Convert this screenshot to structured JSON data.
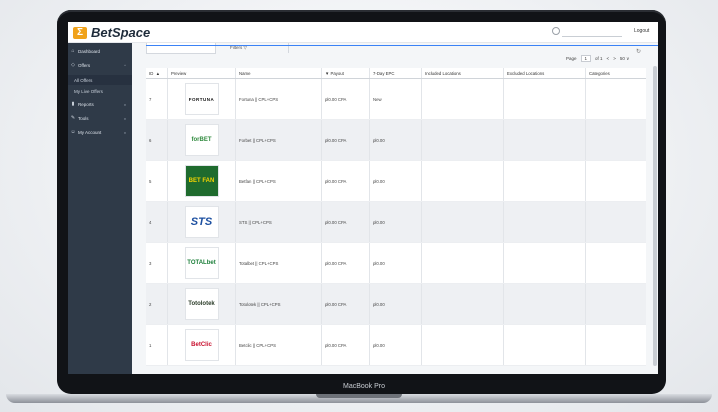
{
  "app": {
    "name": "BetSpace",
    "logout": "Logout"
  },
  "sidebar": {
    "items": [
      {
        "label": "Dashboard",
        "icon": "home-icon"
      },
      {
        "label": "Offers",
        "icon": "tag-icon"
      },
      {
        "label": "All Offers",
        "icon": ""
      },
      {
        "label": "My Live Offers",
        "icon": ""
      },
      {
        "label": "Reports",
        "icon": "bar-chart-icon"
      },
      {
        "label": "Tools",
        "icon": "tools-icon"
      },
      {
        "label": "My Account",
        "icon": "user-icon"
      }
    ]
  },
  "toolbar": {
    "filters_label": "Filters ▽",
    "refresh": "↻"
  },
  "pager": {
    "page_label": "Page",
    "page_value": "1",
    "of_label": "of 1",
    "prev": "<",
    "next": ">",
    "per_page": "50 ∨"
  },
  "table": {
    "headers": [
      "ID",
      "Preview",
      "Name",
      "Payout",
      "7-Day EPC",
      "Included Locations",
      "Excluded Locations",
      "Categories"
    ],
    "id_sort": "▲",
    "payout_sort": "▼",
    "rows": [
      {
        "id": "7",
        "brand": "FORTUNA",
        "brand_color": "#111111",
        "name": "Fortuna || CPL+CPS",
        "payout": "pl0.00 CPA",
        "epc": "New"
      },
      {
        "id": "6",
        "brand": "forBET",
        "brand_color": "#2f8a3d",
        "name": "Forbet || CPL+CPS",
        "payout": "pl0.00 CPA",
        "epc": "pl0.00"
      },
      {
        "id": "5",
        "brand": "BET FAN",
        "brand_color": "#f5d400",
        "name": "Betfan || CPL+CPS",
        "payout": "pl0.00 CPA",
        "epc": "pl0.00"
      },
      {
        "id": "4",
        "brand": "STS",
        "brand_color": "#1c4fa0",
        "name": "STS || CPL+CPS",
        "payout": "pl0.00 CPA",
        "epc": "pl0.00"
      },
      {
        "id": "3",
        "brand": "TOTALbet",
        "brand_color": "#1c7f3a",
        "name": "Totalbet || CPL+CPS",
        "payout": "pl0.00 CPA",
        "epc": "pl0.00"
      },
      {
        "id": "2",
        "brand": "Totolotek",
        "brand_color": "#2c3d2a",
        "name": "Totolotek || CPL+CPS",
        "payout": "pl0.00 CPA",
        "epc": "pl0.00"
      },
      {
        "id": "1",
        "brand": "BetClic",
        "brand_color": "#c8102e",
        "name": "Betclic || CPL+CPS",
        "payout": "pl0.00 CPA",
        "epc": "pl0.00"
      }
    ]
  },
  "device": {
    "label": "MacBook Pro"
  }
}
